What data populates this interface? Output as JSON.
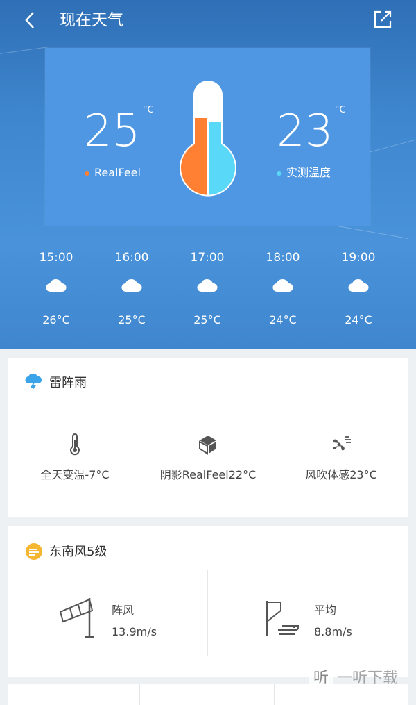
{
  "header": {
    "title": "现在天气",
    "back_icon": "chevron-left-icon",
    "share_icon": "share-icon"
  },
  "current": {
    "realfeel_value": "25",
    "realfeel_unit": "°C",
    "realfeel_label": "RealFeel",
    "realfeel_color": "#ff8033",
    "measured_value": "23",
    "measured_unit": "°C",
    "measured_label": "实测温度",
    "measured_color": "#5ad8f8"
  },
  "hourly": [
    {
      "time": "15:00",
      "icon": "cloud-icon",
      "temp": "26°C"
    },
    {
      "time": "16:00",
      "icon": "cloud-icon",
      "temp": "25°C"
    },
    {
      "time": "17:00",
      "icon": "cloud-icon",
      "temp": "25°C"
    },
    {
      "time": "18:00",
      "icon": "cloud-icon",
      "temp": "24°C"
    },
    {
      "time": "19:00",
      "icon": "cloud-icon",
      "temp": "24°C"
    }
  ],
  "condition": {
    "title": "雷阵雨",
    "icon": "thunderstorm-icon",
    "metrics": [
      {
        "icon": "thermometer-icon",
        "label": "全天变温-7°C"
      },
      {
        "icon": "shade-icon",
        "label": "阴影RealFeel22°C"
      },
      {
        "icon": "wind-chill-icon",
        "label": "风吹体感23°C"
      }
    ]
  },
  "wind": {
    "title": "东南风5级",
    "icon": "wind-badge-icon",
    "gust_label": "阵风",
    "gust_value": "13.9m/s",
    "avg_label": "平均",
    "avg_value": "8.8m/s"
  },
  "watermark": {
    "logo_char": "听",
    "text": "一听下载"
  }
}
